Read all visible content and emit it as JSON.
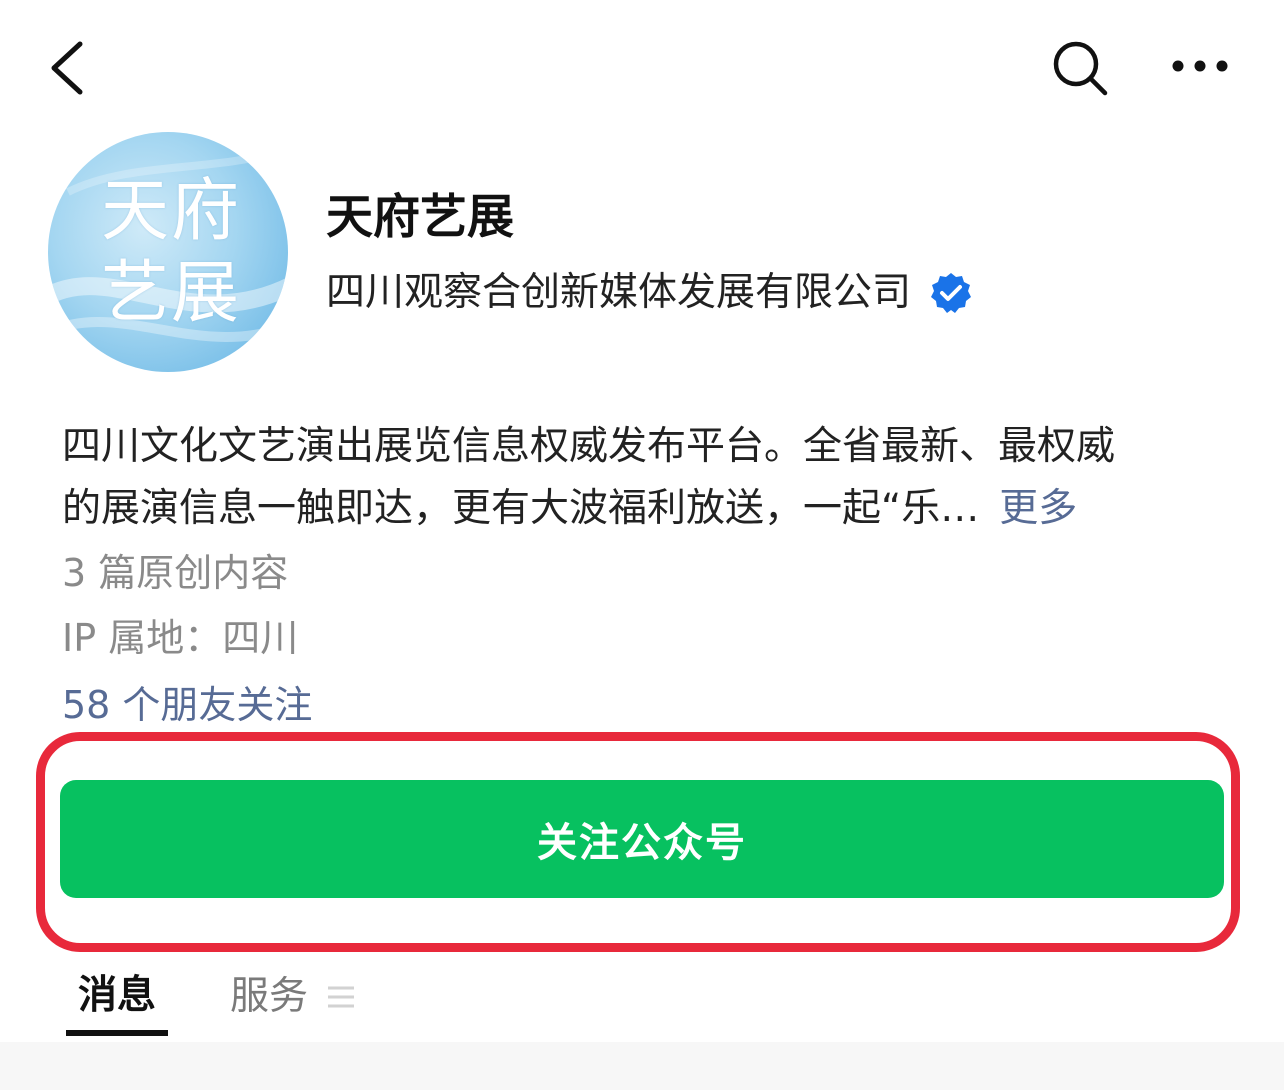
{
  "nav": {
    "back_icon": "chevron-left-icon",
    "search_icon": "search-icon",
    "more_icon": "more-dots-icon"
  },
  "avatar": {
    "line1": "天府",
    "line2": "艺展"
  },
  "account": {
    "name": "天府艺展",
    "company": "四川观察合创新媒体发展有限公司",
    "verified_icon": "verified-badge-icon",
    "verified_color": "#1a73e8"
  },
  "description": {
    "line1": "四川文化文艺演出展览信息权威发布平台。全省最新、最权威",
    "line2": "的展演信息一触即达，更有大波福利放送，一起“乐…",
    "more_label": "更多"
  },
  "meta": {
    "original_count": "3 篇原创内容",
    "ip_location": "IP 属地：四川",
    "friends_follow": "58 个朋友关注"
  },
  "follow_button": {
    "label": "关注公众号",
    "color": "#07c160"
  },
  "highlight": {
    "color": "#e8293b"
  },
  "tabs": [
    {
      "label": "消息",
      "active": true
    },
    {
      "label": "服务",
      "active": false,
      "icon": "menu-lines-icon"
    }
  ]
}
